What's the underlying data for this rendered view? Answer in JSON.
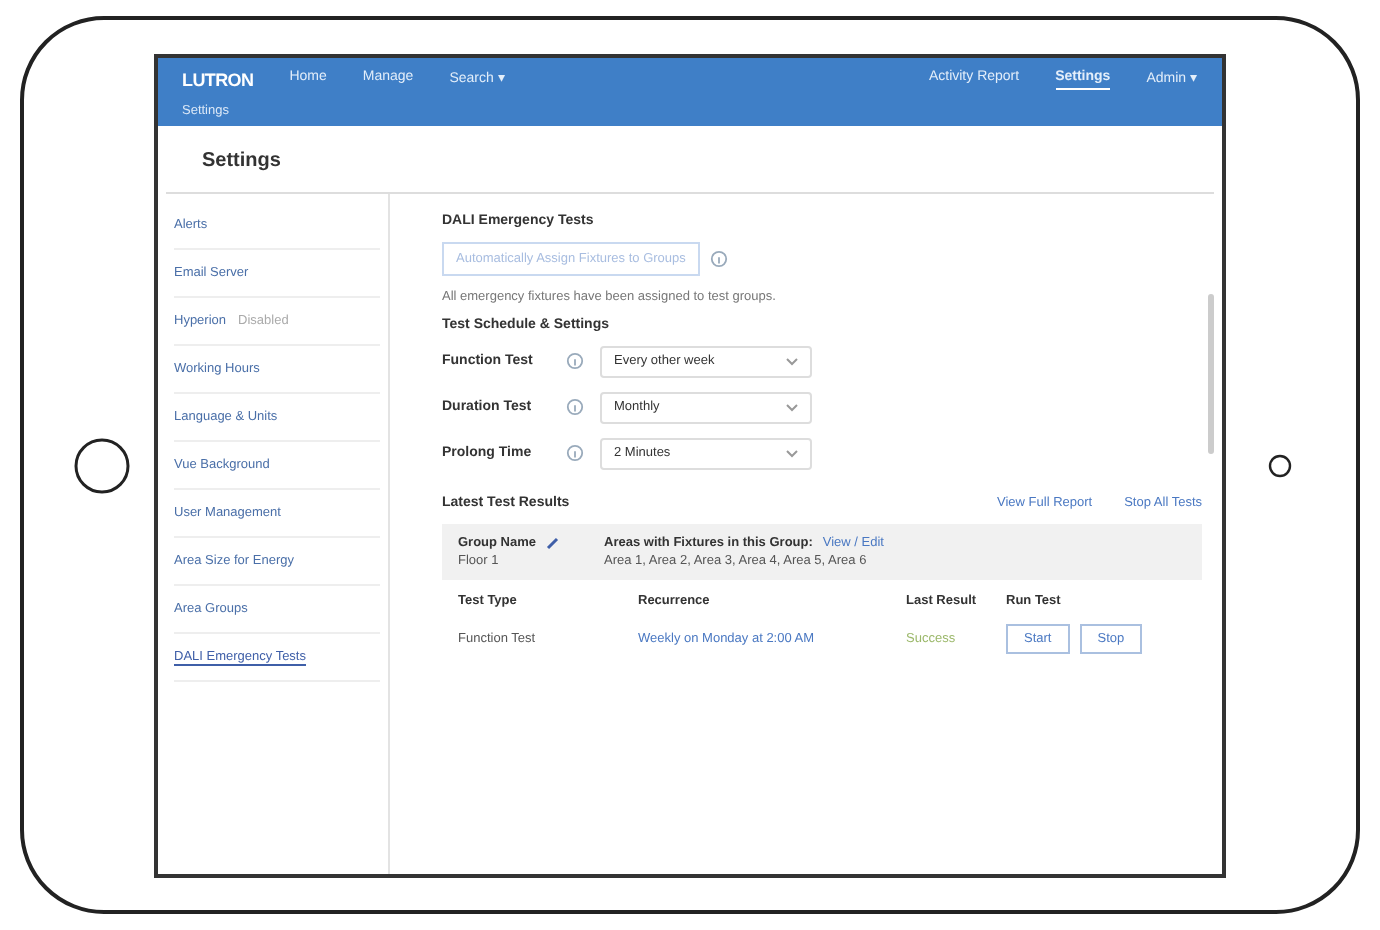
{
  "navbar": {
    "logo": "LUTRON",
    "left_items": [
      {
        "label": "Home",
        "selected": false
      },
      {
        "label": "Manage",
        "selected": false
      },
      {
        "label": "Search ▾",
        "selected": false
      }
    ],
    "right_items": [
      {
        "label": "Activity Report",
        "selected": false
      },
      {
        "label": "Settings",
        "selected": true
      },
      {
        "label": "Admin ▾",
        "selected": false
      }
    ],
    "breadcrumb": "Settings"
  },
  "page_title": "Settings",
  "sidebar": {
    "items": [
      {
        "label": "Alerts",
        "selected": false
      },
      {
        "label": "Email Server",
        "selected": false
      },
      {
        "label": "Hyperion",
        "status": "Disabled",
        "selected": false
      },
      {
        "label": "Working Hours",
        "selected": false
      },
      {
        "label": "Language & Units",
        "selected": false
      },
      {
        "label": "Vue Background",
        "selected": false
      },
      {
        "label": "User Management",
        "selected": false
      },
      {
        "label": "Area Size for Energy",
        "selected": false
      },
      {
        "label": "Area Groups",
        "selected": false
      },
      {
        "label": "DALI Emergency Tests",
        "selected": true
      }
    ]
  },
  "content": {
    "title": "DALI Emergency Tests",
    "assign_button": {
      "label": "Automatically Assign Fixtures to Groups",
      "disabled": true
    },
    "note": "All emergency fixtures have been assigned to test groups.",
    "schedule_title": "Test Schedule & Settings",
    "settings": [
      {
        "label": "Function Test",
        "value": "Every other week"
      },
      {
        "label": "Duration Test",
        "value": "Monthly"
      },
      {
        "label": "Prolong Time",
        "value": "2 Minutes"
      }
    ],
    "results_title": "Latest Test Results",
    "results_links": [
      "View Full Report",
      "Stop All Tests"
    ],
    "group": {
      "name_label": "Group Name",
      "name": "Floor 1",
      "areas_label": "Areas with Fixtures in this Group:",
      "areas_link": "View / Edit",
      "areas": "Area 1, Area 2, Area 3, Area 4, Area 5, Area 6"
    },
    "table": {
      "columns": [
        "Test Type",
        "Recurrence",
        "Last Result",
        "Run Test"
      ],
      "rows": [
        {
          "type": "Function Test",
          "recurrence": "Weekly on Monday at 2:00 AM",
          "result": "Success",
          "buttons": [
            "Start",
            "Stop"
          ]
        }
      ]
    }
  }
}
